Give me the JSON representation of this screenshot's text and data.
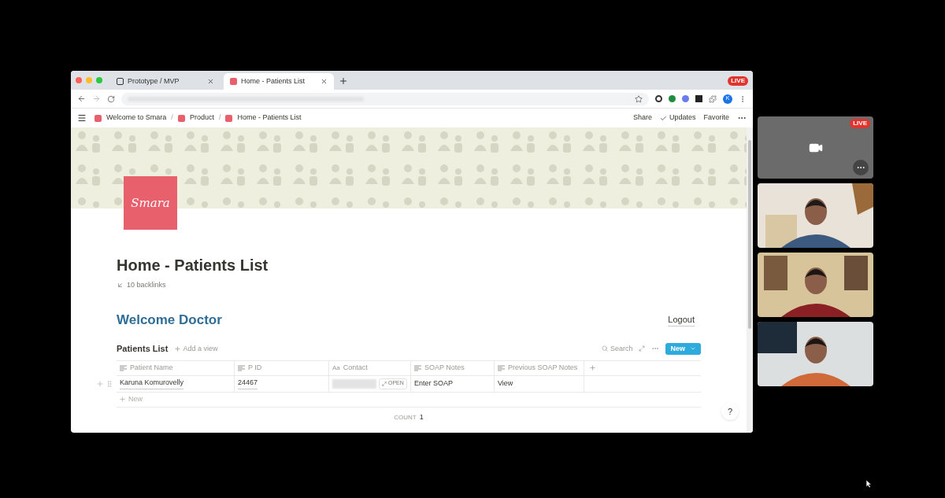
{
  "browser": {
    "tabs": [
      {
        "title": "Prototype / MVP",
        "selected": false
      },
      {
        "title": "Home - Patients List",
        "selected": true
      }
    ],
    "live_badge": "LIVE",
    "profile_initial": "K"
  },
  "topbar": {
    "separator": "/",
    "breadcrumbs": [
      "Welcome to Smara",
      "Product",
      "Home - Patients List"
    ],
    "actions": [
      "Share",
      "Updates",
      "Favorite"
    ]
  },
  "page": {
    "logo_text": "Smara",
    "title": "Home - Patients List",
    "backlinks": "10 backlinks",
    "welcome": "Welcome Doctor",
    "logout": "Logout"
  },
  "database": {
    "title": "Patients List",
    "add_view": "Add a view",
    "search": "Search",
    "new_button": "New",
    "columns": [
      {
        "label": "Patient Name",
        "kind": "text"
      },
      {
        "label": "P ID",
        "kind": "text"
      },
      {
        "label": "Contact",
        "kind": "title",
        "icon_text": "Aa"
      },
      {
        "label": "SOAP Notes",
        "kind": "text"
      },
      {
        "label": "Previous SOAP Notes",
        "kind": "text"
      }
    ],
    "rows": [
      {
        "patient_name": "Karuna Komurovelly",
        "p_id": "24467",
        "contact_action": "OPEN",
        "soap_notes": "Enter SOAP",
        "previous_soap_notes": "View"
      }
    ],
    "new_row": "New",
    "count_label": "COUNT",
    "count_value": "1"
  },
  "help": "?",
  "call": {
    "live_badge": "LIVE"
  }
}
